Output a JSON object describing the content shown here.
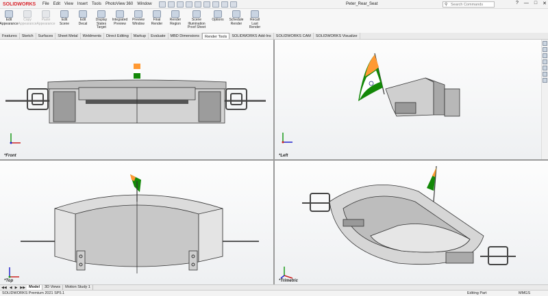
{
  "app": {
    "logo": "SOLIDWORKS",
    "doc_title": "Peter_Rear_Seat"
  },
  "menu": [
    "File",
    "Edit",
    "View",
    "Insert",
    "Tools",
    "PhotoView 360",
    "Window"
  ],
  "search": {
    "placeholder": "Search Commands"
  },
  "ribbon": [
    {
      "label": "Edit Appearance",
      "enabled": true
    },
    {
      "label": "Copy Appearance",
      "enabled": false
    },
    {
      "label": "Paste Appearance",
      "enabled": false
    },
    {
      "label": "Edit Scene",
      "enabled": true
    },
    {
      "label": "Edit Decal",
      "enabled": true
    },
    {
      "label": "Display States Target",
      "enabled": true
    },
    {
      "label": "Integrated Preview",
      "enabled": true
    },
    {
      "label": "Preview Window",
      "enabled": true
    },
    {
      "label": "Final Render",
      "enabled": true
    },
    {
      "label": "Render Region",
      "enabled": true
    },
    {
      "label": "Scene Illumination Proof Sheet",
      "enabled": true
    },
    {
      "label": "Options",
      "enabled": true
    },
    {
      "label": "Schedule Render",
      "enabled": true
    },
    {
      "label": "Recall Last Render",
      "enabled": true
    }
  ],
  "command_tabs": [
    "Features",
    "Sketch",
    "Surfaces",
    "Sheet Metal",
    "Weldments",
    "Direct Editing",
    "Markup",
    "Evaluate",
    "MBD Dimensions",
    "Render Tools",
    "SOLIDWORKS Add-Ins",
    "SOLIDWORKS CAM",
    "SOLIDWORKS Visualize"
  ],
  "active_command_tab": "Render Tools",
  "viewports": {
    "front": "*Front",
    "left": "*Left",
    "top": "*Top",
    "trimetric": "*Trimetric"
  },
  "bottom_tabs": [
    "Model",
    "3D Views",
    "Motion Study 1"
  ],
  "status": {
    "left": "SOLIDWORKS Premium 2021 SP5.1",
    "mode": "Editing Part",
    "units": "MMGS"
  }
}
